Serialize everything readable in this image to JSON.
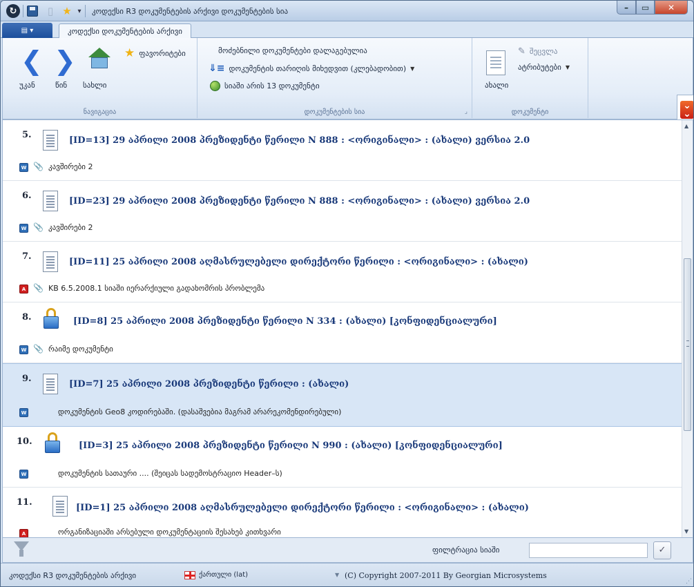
{
  "window": {
    "title": "კოდექსი R3 დოკუმენტების არქივი დოკუმენტების სია"
  },
  "tabs": [
    {
      "label": "კოდექსი დოკუმენტების არქივი",
      "active": true
    }
  ],
  "ribbon": {
    "navigation": {
      "group_label": "ნავიგაცია",
      "back_label": "უკან",
      "forward_label": "წინ",
      "home_label": "სახლი",
      "favorites_label": "ფავორიტები"
    },
    "doclist": {
      "group_label": "დოკუმენტების სია",
      "status_label": "მოძებნილი დოკუმენტები დალაგებულია",
      "sort_label": "დოკუმენტის თარიღის მიხედვით (კლებადობით)",
      "count_label": "სიაში არის 13 დოკუმენტი"
    },
    "document": {
      "group_label": "დოკუმენტი",
      "new_label": "ახალი",
      "edit_label": "შეცვლა",
      "attributes_label": "ატრიბუტები"
    }
  },
  "records": [
    {
      "num": "5.",
      "icon": "document-icon",
      "title": "[ID=13] 29 აპრილი 2008 პრეზიდენტი წერილი N 888 : <ორიგინალი> : (ახალი) ვერსია 2.0",
      "file_icon": "word-icon",
      "attachment": true,
      "desc": "კავშირები 2",
      "selected": false
    },
    {
      "num": "6.",
      "icon": "document-icon",
      "title": "[ID=23] 29 აპრილი 2008 პრეზიდენტი წერილი N 888 : <ორიგინალი> : (ახალი) ვერსია 2.0",
      "file_icon": "word-icon",
      "attachment": true,
      "desc": "კავშირები 2",
      "selected": false
    },
    {
      "num": "7.",
      "icon": "document-icon",
      "title": "[ID=11] 25 აპრილი 2008 აღმასრულებელი დირექტორი წერილი : <ორიგინალი> : (ახალი)",
      "file_icon": "pdf-icon",
      "attachment": true,
      "desc": "KB 6.5.2008.1 სიაში იერარქიული გადახომრის პრობლემა",
      "selected": false
    },
    {
      "num": "8.",
      "icon": "lock-icon",
      "title": "[ID=8] 25 აპრილი 2008 პრეზიდენტი წერილი N 334 : (ახალი) [კონფიდენციალური]",
      "file_icon": "word-icon",
      "attachment": true,
      "desc": "რაიმე დოკუმენტი",
      "selected": false
    },
    {
      "num": "9.",
      "icon": "document-icon",
      "title": "[ID=7] 25 აპრილი 2008 პრეზიდენტი წერილი : (ახალი)",
      "file_icon": "word-icon",
      "attachment": false,
      "desc": "დოკუმენტის Geo8 კოდირებაში. (დასაშვებია მაგრამ არარეკომენდირებული)",
      "selected": true
    },
    {
      "num": "10.",
      "icon": "lock-icon",
      "title": "[ID=3] 25 აპრილი 2008 პრეზიდენტი წერილი N 990 : (ახალი) [კონფიდენციალური]",
      "file_icon": "word-icon",
      "attachment": false,
      "desc": "დოკუმენტის სათაური .... (შეიცას სადემოსტრაციო Header–ს)",
      "selected": false
    },
    {
      "num": "11.",
      "icon": "document-icon",
      "title": "[ID=1] 25 აპრილი 2008 აღმასრულებელი დირექტორი წერილი : <ორიგინალი> : (ახალი)",
      "file_icon": "pdf-icon",
      "attachment": false,
      "desc": "ორგანიზაციაში არსებული დოკუმენტაციის შესახებ კითხვარი",
      "selected": false
    }
  ],
  "filter": {
    "label": "ფილტრაცია სიაში",
    "value": ""
  },
  "statusbar": {
    "app_label": "კოდექსი R3 დოკუმენტების არქივი",
    "language": "ქართული (lat)",
    "copyright": "(C) Copyright 2007-2011 By Georgian Microsystems"
  }
}
